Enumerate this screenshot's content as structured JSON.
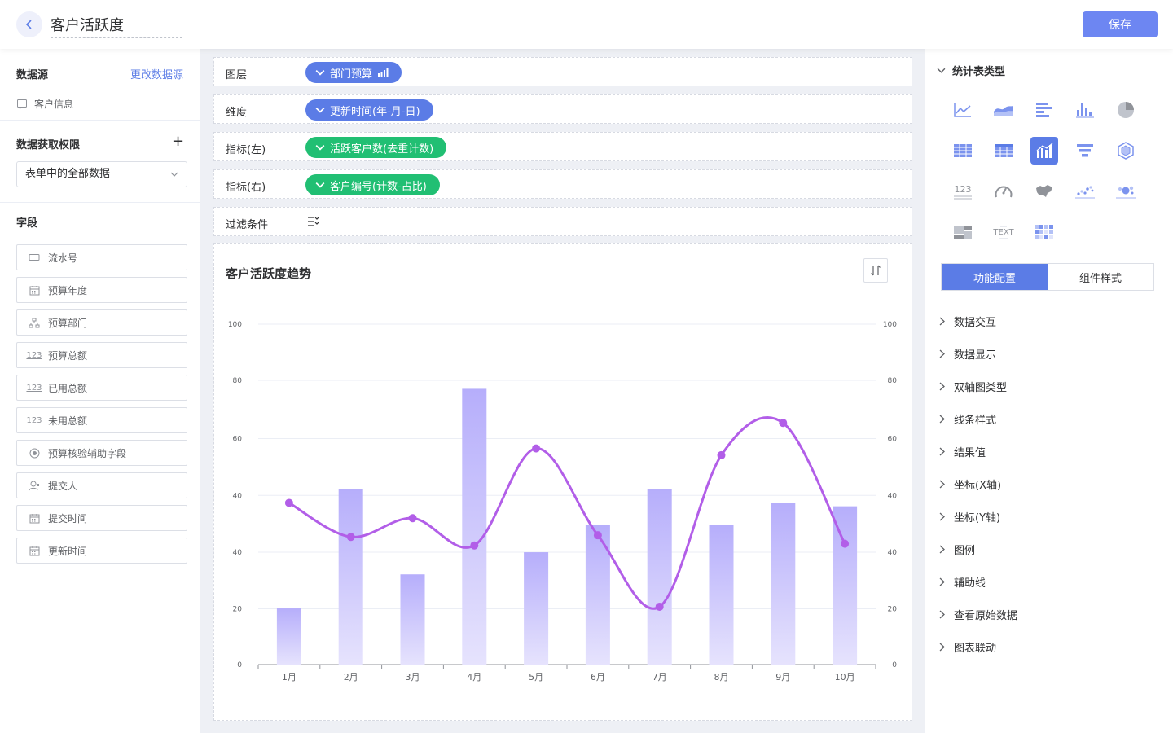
{
  "header": {
    "title": "客户活跃度",
    "save_label": "保存"
  },
  "left": {
    "datasource_title": "数据源",
    "change_source_label": "更改数据源",
    "source_name": "客户信息",
    "permission_title": "数据获取权限",
    "permission_value": "表单中的全部数据",
    "fields_title": "字段",
    "fields": [
      {
        "label": "流水号",
        "icon": "id-card-icon"
      },
      {
        "label": "预算年度",
        "icon": "calendar-icon"
      },
      {
        "label": "预算部门",
        "icon": "org-tree-icon"
      },
      {
        "label": "预算总额",
        "icon": "number-icon"
      },
      {
        "label": "已用总额",
        "icon": "number-icon"
      },
      {
        "label": "未用总额",
        "icon": "number-icon"
      },
      {
        "label": "预算核验辅助字段",
        "icon": "radio-icon"
      },
      {
        "label": "提交人",
        "icon": "user-icon"
      },
      {
        "label": "提交时间",
        "icon": "calendar-icon"
      },
      {
        "label": "更新时间",
        "icon": "calendar-icon"
      }
    ]
  },
  "config_rows": [
    {
      "label": "图层",
      "pill": "部门预算",
      "color": "#5b7ce6"
    },
    {
      "label": "维度",
      "pill": "更新时间(年-月-日)",
      "color": "#5b7ce6"
    },
    {
      "label": "指标(左)",
      "pill": "活跃客户数(去重计数)",
      "color": "#21bf73"
    },
    {
      "label": "指标(右)",
      "pill": "客户编号(计数-占比)",
      "color": "#21bf73"
    }
  ],
  "filter_label": "过滤条件",
  "chart_data": {
    "type": "bar+line",
    "title": "客户活跃度趋势",
    "categories": [
      "1月",
      "2月",
      "3月",
      "4月",
      "5月",
      "6月",
      "7月",
      "8月",
      "9月",
      "10月"
    ],
    "bar_values": [
      16.5,
      51.5,
      26.5,
      81,
      33,
      41,
      51.5,
      41,
      47.5,
      46.5
    ],
    "line_values": [
      47.5,
      37.5,
      43,
      35,
      63.5,
      38,
      17,
      61.5,
      71,
      35.5
    ],
    "y_left_ticks": [
      "0",
      "20",
      "40",
      "60",
      "80",
      "100"
    ],
    "y_right_ticks": [
      "0",
      "20",
      "40",
      "60",
      "80",
      "100"
    ],
    "y_left_ticks_display": [
      "0",
      "20",
      "40",
      "40",
      "60",
      "80",
      "100"
    ],
    "y_right_ticks_display": [
      "0",
      "20",
      "40",
      "40",
      "60",
      "80",
      "100"
    ],
    "bar_color": "#b6aefb",
    "line_color": "#b25ee8",
    "grid": true
  },
  "right": {
    "chart_type_title": "统计表类型",
    "tabs": [
      "功能配置",
      "组件样式"
    ],
    "config_items": [
      "数据交互",
      "数据显示",
      "双轴图类型",
      "线条样式",
      "结果值",
      "坐标(X轴)",
      "坐标(Y轴)",
      "图例",
      "辅助线",
      "查看原始数据",
      "图表联动"
    ],
    "chart_types": [
      "line-chart-icon",
      "area-chart-icon",
      "horizontal-bar-icon",
      "column-chart-icon",
      "pie-chart-icon",
      "table-icon",
      "pivot-table-icon",
      "dual-axis-icon",
      "funnel-icon",
      "radar-icon",
      "number-card-icon",
      "gauge-icon",
      "map-icon",
      "scatter-icon",
      "bubble-icon",
      "treemap-icon",
      "word-cloud-icon",
      "heatmap-icon"
    ],
    "number_card_text": "123",
    "word_cloud_text": "TEXT"
  }
}
